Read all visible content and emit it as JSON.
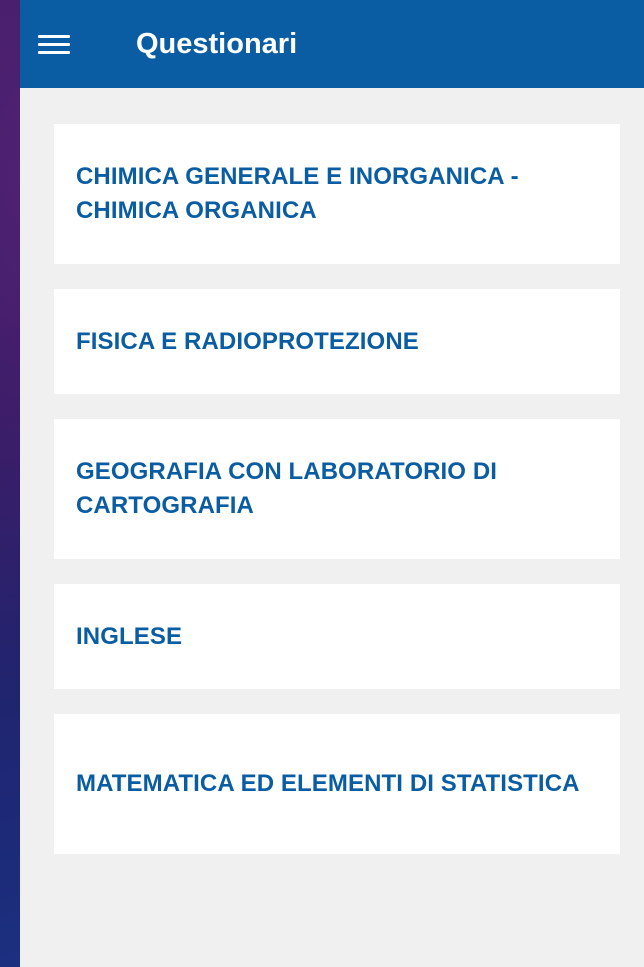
{
  "header": {
    "menu_icon": "hamburger-menu-icon",
    "title": "Questionari"
  },
  "questionnaires": [
    {
      "label": "CHIMICA GENERALE E INORGANICA - CHIMICA ORGANICA"
    },
    {
      "label": "FISICA E RADIOPROTEZIONE"
    },
    {
      "label": "GEOGRAFIA CON LABORATORIO DI CARTOGRAFIA"
    },
    {
      "label": "INGLESE"
    },
    {
      "label": "MATEMATICA ED ELEMENTI DI STATISTICA"
    }
  ],
  "colors": {
    "app_bar": "#0b5da3",
    "card_text": "#0b5da3",
    "card_background": "#ffffff",
    "page_background": "#f0f0f0"
  }
}
